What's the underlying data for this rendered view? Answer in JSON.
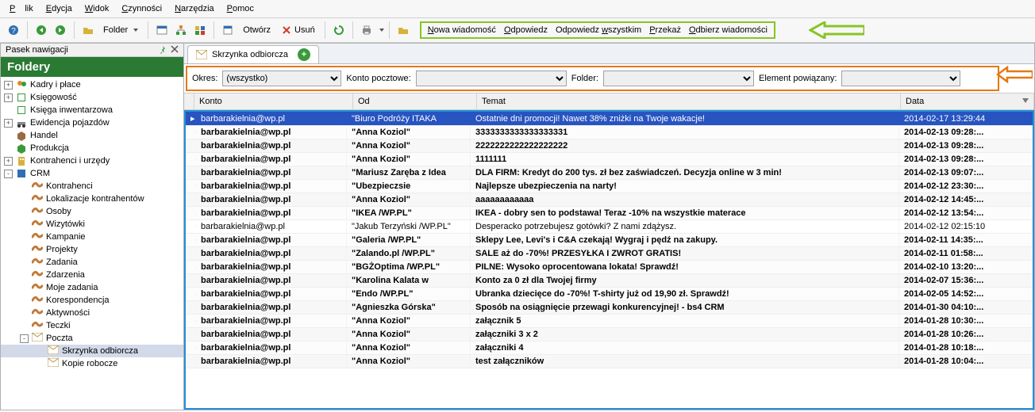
{
  "menu": {
    "items": [
      "Plik",
      "Edycja",
      "Widok",
      "Czynności",
      "Narzędzia",
      "Pomoc"
    ]
  },
  "toolbar": {
    "folder_label": "Folder",
    "open_label": "Otwórz",
    "delete_label": "Usuń"
  },
  "msg_links": [
    "Nowa wiadomość",
    "Odpowiedz",
    "Odpowiedz wszystkim",
    "Przekaż",
    "Odbierz wiadomości"
  ],
  "sidebar": {
    "nav_title": "Pasek nawigacji",
    "foldery_title": "Foldery",
    "items": [
      {
        "exp": "+",
        "icon": "people",
        "label": "Kadry i płace",
        "indent": 0
      },
      {
        "exp": "+",
        "icon": "book",
        "label": "Księgowość",
        "indent": 0
      },
      {
        "exp": "",
        "icon": "book",
        "label": "Księga inwentarzowa",
        "indent": 0
      },
      {
        "exp": "+",
        "icon": "car",
        "label": "Ewidencja pojazdów",
        "indent": 0
      },
      {
        "exp": "",
        "icon": "box",
        "label": "Handel",
        "indent": 0
      },
      {
        "exp": "",
        "icon": "box2",
        "label": "Produkcja",
        "indent": 0
      },
      {
        "exp": "+",
        "icon": "building",
        "label": "Kontrahenci i urzędy",
        "indent": 0
      },
      {
        "exp": "-",
        "icon": "crm",
        "label": "CRM",
        "indent": 0
      },
      {
        "exp": "",
        "icon": "worm",
        "label": "Kontrahenci",
        "indent": 1
      },
      {
        "exp": "",
        "icon": "worm",
        "label": "Lokalizacje kontrahentów",
        "indent": 1
      },
      {
        "exp": "",
        "icon": "worm",
        "label": "Osoby",
        "indent": 1
      },
      {
        "exp": "",
        "icon": "worm",
        "label": "Wizytówki",
        "indent": 1
      },
      {
        "exp": "",
        "icon": "worm",
        "label": "Kampanie",
        "indent": 1
      },
      {
        "exp": "",
        "icon": "worm",
        "label": "Projekty",
        "indent": 1
      },
      {
        "exp": "",
        "icon": "worm",
        "label": "Zadania",
        "indent": 1
      },
      {
        "exp": "",
        "icon": "worm",
        "label": "Zdarzenia",
        "indent": 1
      },
      {
        "exp": "",
        "icon": "worm",
        "label": "Moje zadania",
        "indent": 1
      },
      {
        "exp": "",
        "icon": "worm",
        "label": "Korespondencja",
        "indent": 1
      },
      {
        "exp": "",
        "icon": "worm",
        "label": "Aktywności",
        "indent": 1
      },
      {
        "exp": "",
        "icon": "worm",
        "label": "Teczki",
        "indent": 1
      },
      {
        "exp": "-",
        "icon": "mail",
        "label": "Poczta",
        "indent": 1
      },
      {
        "exp": "",
        "icon": "mail",
        "label": "Skrzynka odbiorcza",
        "indent": 2,
        "selected": true
      },
      {
        "exp": "",
        "icon": "mail",
        "label": "Kopie robocze",
        "indent": 2
      }
    ]
  },
  "tab": {
    "label": "Skrzynka odbiorcza"
  },
  "filters": {
    "okres_label": "Okres:",
    "okres_value": "(wszystko)",
    "konto_label": "Konto pocztowe:",
    "folder_label": "Folder:",
    "element_label": "Element powiązany:"
  },
  "grid": {
    "head": {
      "konto": "Konto",
      "od": "Od",
      "temat": "Temat",
      "data": "Data"
    },
    "rows": [
      {
        "sel": true,
        "unread": false,
        "konto": "barbarakielnia@wp.pl",
        "od": "\"Biuro Podróży ITAKA",
        "temat": "Ostatnie dni promocji! Nawet 38% zniżki na Twoje wakacje!",
        "data": "2014-02-17 13:29:44"
      },
      {
        "unread": true,
        "konto": "barbarakielnia@wp.pl",
        "od": "\"Anna Koziol\"",
        "temat": "3333333333333333331",
        "data": "2014-02-13 09:28:..."
      },
      {
        "unread": true,
        "konto": "barbarakielnia@wp.pl",
        "od": "\"Anna Koziol\"",
        "temat": "2222222222222222222",
        "data": "2014-02-13 09:28:..."
      },
      {
        "unread": true,
        "konto": "barbarakielnia@wp.pl",
        "od": "\"Anna Koziol\"",
        "temat": "1111111",
        "data": "2014-02-13 09:28:..."
      },
      {
        "unread": true,
        "konto": "barbarakielnia@wp.pl",
        "od": "\"Mariusz Zaręba z Idea",
        "temat": "DLA FIRM: Kredyt do 200 tys. zł bez zaświadczeń. Decyzja online w 3 min!",
        "data": "2014-02-13 09:07:..."
      },
      {
        "unread": true,
        "konto": "barbarakielnia@wp.pl",
        "od": "\"Ubezpieczsie",
        "temat": "Najlepsze ubezpieczenia na narty!",
        "data": "2014-02-12 23:30:..."
      },
      {
        "unread": true,
        "konto": "barbarakielnia@wp.pl",
        "od": "\"Anna Koziol\"",
        "temat": "aaaaaaaaaaaa",
        "data": "2014-02-12 14:45:..."
      },
      {
        "unread": true,
        "konto": "barbarakielnia@wp.pl",
        "od": "\"IKEA /WP.PL\"",
        "temat": "IKEA - dobry sen to podstawa! Teraz -10% na wszystkie materace",
        "data": "2014-02-12 13:54:..."
      },
      {
        "unread": false,
        "konto": "barbarakielnia@wp.pl",
        "od": "\"Jakub Terzyński /WP.PL\"",
        "temat": "Desperacko potrzebujesz gotówki? Z nami zdążysz.",
        "data": "2014-02-12 02:15:10"
      },
      {
        "unread": true,
        "konto": "barbarakielnia@wp.pl",
        "od": "\"Galeria /WP.PL\"",
        "temat": "Sklepy Lee, Levi's i C&A czekają! Wygraj i pędź na zakupy.",
        "data": "2014-02-11 14:35:..."
      },
      {
        "unread": true,
        "konto": "barbarakielnia@wp.pl",
        "od": "\"Zalando.pl /WP.PL\"",
        "temat": "SALE aż do -70%! PRZESYŁKA I ZWROT GRATIS!",
        "data": "2014-02-11 01:58:..."
      },
      {
        "unread": true,
        "konto": "barbarakielnia@wp.pl",
        "od": "\"BGŻOptima /WP.PL\"",
        "temat": "PILNE: Wysoko oprocentowana lokata! Sprawdź!",
        "data": "2014-02-10 13:20:..."
      },
      {
        "unread": true,
        "konto": "barbarakielnia@wp.pl",
        "od": "\"Karolina Kalata w",
        "temat": "Konto za 0 zł dla Twojej firmy",
        "data": "2014-02-07 15:36:..."
      },
      {
        "unread": true,
        "konto": "barbarakielnia@wp.pl",
        "od": "\"Endo /WP.PL\"",
        "temat": "Ubranka dziecięce do -70%! T-shirty już od 19,90 zł. Sprawdź!",
        "data": "2014-02-05 14:52:..."
      },
      {
        "unread": true,
        "konto": "barbarakielnia@wp.pl",
        "od": "\"Agnieszka Górska\"",
        "temat": "Sposób na osiągnięcie przewagi konkurencyjnej! - bs4 CRM",
        "data": "2014-01-30 04:10:..."
      },
      {
        "unread": true,
        "konto": "barbarakielnia@wp.pl",
        "od": "\"Anna Koziol\"",
        "temat": "załącznik 5",
        "data": "2014-01-28 10:30:..."
      },
      {
        "unread": true,
        "konto": "barbarakielnia@wp.pl",
        "od": "\"Anna Koziol\"",
        "temat": "załączniki 3 x 2",
        "data": "2014-01-28 10:26:..."
      },
      {
        "unread": true,
        "konto": "barbarakielnia@wp.pl",
        "od": "\"Anna Koziol\"",
        "temat": "załączniki 4",
        "data": "2014-01-28 10:18:..."
      },
      {
        "unread": true,
        "konto": "barbarakielnia@wp.pl",
        "od": "\"Anna Koziol\"",
        "temat": "test załączników",
        "data": "2014-01-28 10:04:..."
      }
    ]
  }
}
